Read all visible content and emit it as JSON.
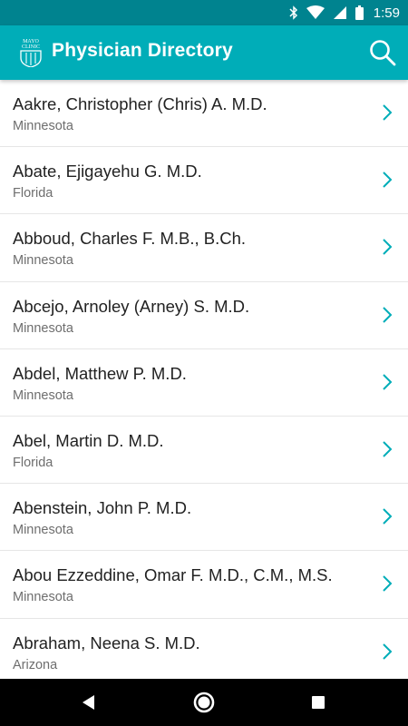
{
  "status_bar": {
    "time": "1:59",
    "icons": [
      "bluetooth-icon",
      "wifi-icon",
      "signal-icon",
      "battery-icon"
    ]
  },
  "app_bar": {
    "title": "Physician Directory",
    "logo_text": "MAYO CLINIC",
    "search_icon": "search-icon"
  },
  "colors": {
    "status_bar": "#00838f",
    "app_bar": "#00adb8",
    "accent": "#00adb8",
    "name_text": "#222222",
    "state_text": "#6e6e6e"
  },
  "physicians": [
    {
      "name": "Aakre, Christopher (Chris) A. M.D.",
      "state": "Minnesota"
    },
    {
      "name": "Abate, Ejigayehu G. M.D.",
      "state": "Florida"
    },
    {
      "name": "Abboud, Charles F. M.B., B.Ch.",
      "state": "Minnesota"
    },
    {
      "name": "Abcejo, Arnoley (Arney) S. M.D.",
      "state": "Minnesota"
    },
    {
      "name": "Abdel, Matthew P. M.D.",
      "state": "Minnesota"
    },
    {
      "name": "Abel, Martin D. M.D.",
      "state": "Florida"
    },
    {
      "name": "Abenstein, John P. M.D.",
      "state": "Minnesota"
    },
    {
      "name": "Abou Ezzeddine, Omar F. M.D., C.M., M.S.",
      "state": "Minnesota"
    },
    {
      "name": "Abraham, Neena S. M.D.",
      "state": "Arizona"
    }
  ],
  "nav": {
    "icons": [
      "back-icon",
      "home-icon",
      "recents-icon"
    ]
  }
}
